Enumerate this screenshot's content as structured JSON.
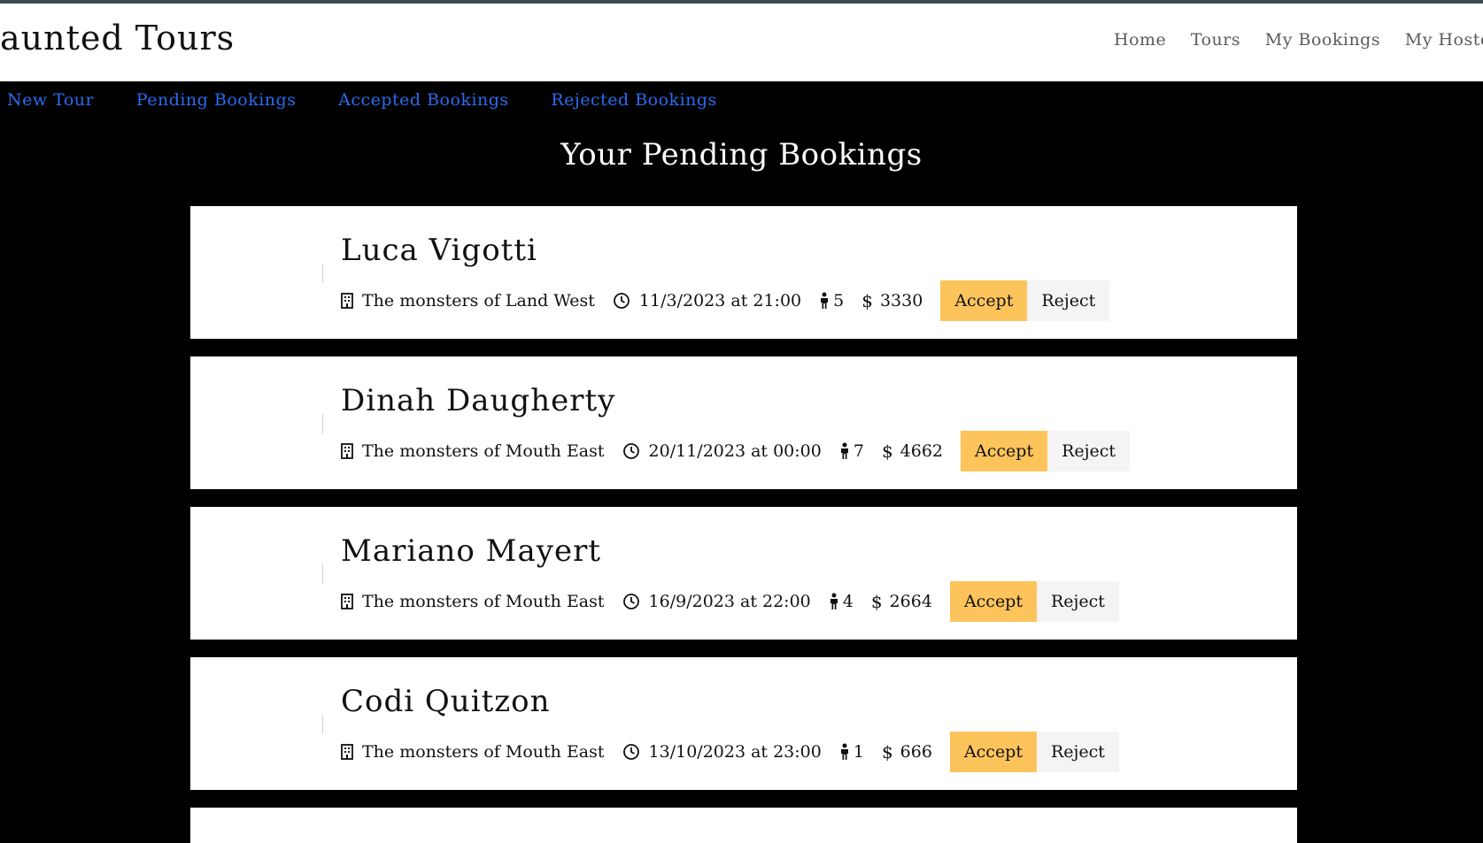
{
  "header": {
    "brand": "aunted Tours",
    "nav": [
      "Home",
      "Tours",
      "My Bookings",
      "My Hosted To"
    ]
  },
  "subnav": [
    "New Tour",
    "Pending Bookings",
    "Accepted Bookings",
    "Rejected Bookings"
  ],
  "page_title": "Your Pending Bookings",
  "bookings": [
    {
      "name": "Luca Vigotti",
      "tour": "The monsters of Land West",
      "datetime": "11/3/2023 at 21:00",
      "people": "5",
      "price": "3330",
      "currency": "$",
      "accept": "Accept",
      "reject": "Reject"
    },
    {
      "name": "Dinah Daugherty",
      "tour": "The monsters of Mouth East",
      "datetime": "20/11/2023 at 00:00",
      "people": "7",
      "price": "4662",
      "currency": "$",
      "accept": "Accept",
      "reject": "Reject"
    },
    {
      "name": "Mariano Mayert",
      "tour": "The monsters of Mouth East",
      "datetime": "16/9/2023 at 22:00",
      "people": "4",
      "price": "2664",
      "currency": "$",
      "accept": "Accept",
      "reject": "Reject"
    },
    {
      "name": "Codi Quitzon",
      "tour": "The monsters of Mouth East",
      "datetime": "13/10/2023 at 23:00",
      "people": "1",
      "price": "666",
      "currency": "$",
      "accept": "Accept",
      "reject": "Reject"
    }
  ],
  "icons": {
    "tour": "building-icon",
    "datetime": "clock-icon",
    "people": "person-icon"
  },
  "colors": {
    "accept_button": "#fdc45c",
    "reject_button": "#f4f4f4",
    "subnav_link": "#2a6cf0",
    "background": "#000000"
  }
}
